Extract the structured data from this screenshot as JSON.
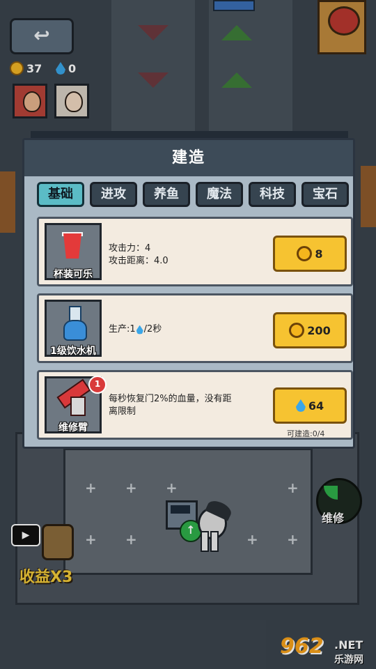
{
  "background": {
    "resources": {
      "coins": "37",
      "water": "0"
    },
    "income_label": "收益X3",
    "repair_label": "维修",
    "watermark": {
      "number": "962",
      "domain": ".NET",
      "site": "乐游网"
    }
  },
  "dialog": {
    "title": "建造",
    "tabs": [
      {
        "label": "基础",
        "active": true
      },
      {
        "label": "进攻",
        "active": false
      },
      {
        "label": "养鱼",
        "active": false
      },
      {
        "label": "魔法",
        "active": false
      },
      {
        "label": "科技",
        "active": false
      },
      {
        "label": "宝石",
        "active": false
      }
    ],
    "items": [
      {
        "name": "杯装可乐",
        "desc_line1": "攻击力：4",
        "desc_line2": "攻击距离：4.0",
        "price": "8",
        "currency": "coin"
      },
      {
        "name": "1级饮水机",
        "desc_prefix": "生产:1",
        "desc_suffix": "/2秒",
        "price": "200",
        "currency": "coin"
      },
      {
        "name": "维修臂",
        "desc_line1": "每秒恢复门2%的血量，没有距",
        "desc_line2": "离限制",
        "price": "64",
        "currency": "water",
        "badge": "1",
        "can_build": "可建造:0/4"
      }
    ]
  },
  "colors": {
    "tab_active": "#5bbcc6",
    "price_button": "#f6c331",
    "header": "#3d4b58",
    "card": "#f3ebe0"
  }
}
